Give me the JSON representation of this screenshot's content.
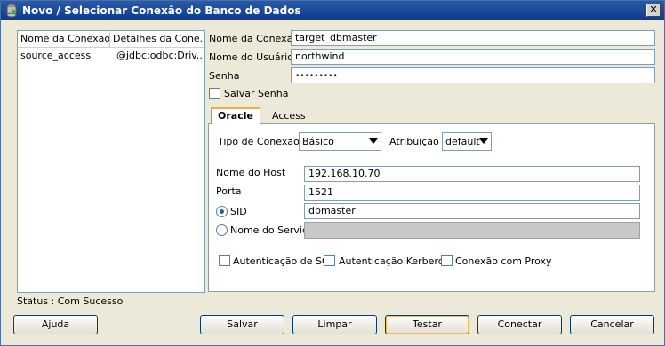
{
  "window": {
    "title": "Novo / Selecionar Conexão do Banco de Dados",
    "close_glyph": "✕"
  },
  "connections": {
    "headers": [
      "Nome da Conexão",
      "Detalhes da Cone..."
    ],
    "rows": [
      {
        "name": "source_access",
        "details": "@jdbc:odbc:Driv..."
      }
    ]
  },
  "form": {
    "connection_name_label": "Nome da Conexão",
    "connection_name_value": "target_dbmaster",
    "username_label": "Nome do Usuário",
    "username_value": "northwind",
    "password_label": "Senha",
    "password_value": "•••••••••",
    "save_password_label": "Salvar Senha",
    "save_password_checked": false
  },
  "tabs": {
    "oracle": "Oracle",
    "access": "Access",
    "active": "Oracle"
  },
  "oracle": {
    "connection_type_label": "Tipo de Conexão",
    "connection_type_value": "Básico",
    "role_label": "Atribuição",
    "role_value": "default",
    "host_label": "Nome do Host",
    "host_value": "192.168.10.70",
    "port_label": "Porta",
    "port_value": "1521",
    "sid_label": "SID",
    "sid_value": "dbmaster",
    "sid_selected": true,
    "service_label": "Nome do Serviço",
    "service_value": "",
    "os_auth_label": "Autenticação de SO",
    "kerberos_label": "Autenticação Kerberos",
    "proxy_label": "Conexão com Proxy"
  },
  "status": "Status : Com Sucesso",
  "buttons": {
    "help": "Ajuda",
    "save": "Salvar",
    "clear": "Limpar",
    "test": "Testar",
    "connect": "Conectar",
    "cancel": "Cancelar"
  },
  "colors": {
    "title_bar": "#0c3a8c",
    "tab_highlight": "#f0a84b",
    "dialog_bg": "#ece9d8"
  }
}
